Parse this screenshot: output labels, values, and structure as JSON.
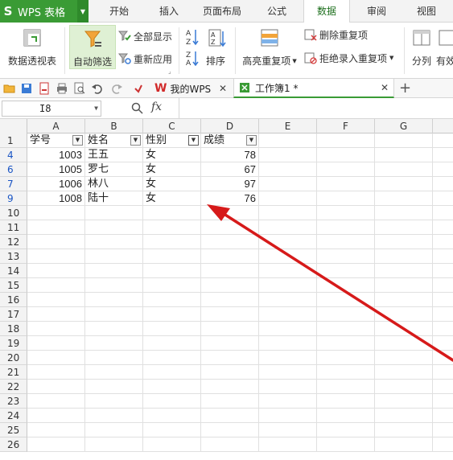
{
  "app": {
    "logo": "S",
    "title": "WPS 表格"
  },
  "menu": {
    "tabs": [
      {
        "label": "开始"
      },
      {
        "label": "插入"
      },
      {
        "label": "页面布局"
      },
      {
        "label": "公式"
      },
      {
        "label": "数据"
      },
      {
        "label": "审阅"
      },
      {
        "label": "视图"
      }
    ],
    "active_tab": "数据"
  },
  "ribbon": {
    "pivot_label": "数据透视表",
    "autofilter_label": "自动筛选",
    "show_all_label": "全部显示",
    "reapply_label": "重新应用",
    "sort_label": "排序",
    "highlight_dup_label": "高亮重复项",
    "remove_dup_label": "删除重复项",
    "reject_dup_label": "拒绝录入重复项",
    "split_label": "分列",
    "valid_label": "有效"
  },
  "doc_tabs": [
    {
      "label": "我的WPS"
    },
    {
      "label": "工作簿1 *"
    }
  ],
  "formula_bar": {
    "cell_ref": "I8",
    "fx": "fx"
  },
  "columns": [
    "A",
    "B",
    "C",
    "D",
    "E",
    "F",
    "G"
  ],
  "table": {
    "headers": [
      "学号",
      "姓名",
      "性别",
      "成绩"
    ],
    "rows": [
      {
        "row": "4",
        "id": "1003",
        "name": "王五",
        "gender": "女",
        "score": "78"
      },
      {
        "row": "6",
        "id": "1005",
        "name": "罗七",
        "gender": "女",
        "score": "67"
      },
      {
        "row": "7",
        "id": "1006",
        "name": "林八",
        "gender": "女",
        "score": "97"
      },
      {
        "row": "9",
        "id": "1008",
        "name": "陆十",
        "gender": "女",
        "score": "76"
      }
    ]
  },
  "row_numbers": [
    "1",
    "4",
    "6",
    "7",
    "9",
    "10",
    "11",
    "12",
    "13",
    "14",
    "15",
    "16",
    "17",
    "18",
    "19",
    "20",
    "21",
    "22",
    "23",
    "24",
    "25",
    "26"
  ],
  "colors": {
    "app_green": "#3a9b35",
    "filtered_row_blue": "#1a55c4",
    "annotation_arrow": "#d61a1a"
  }
}
